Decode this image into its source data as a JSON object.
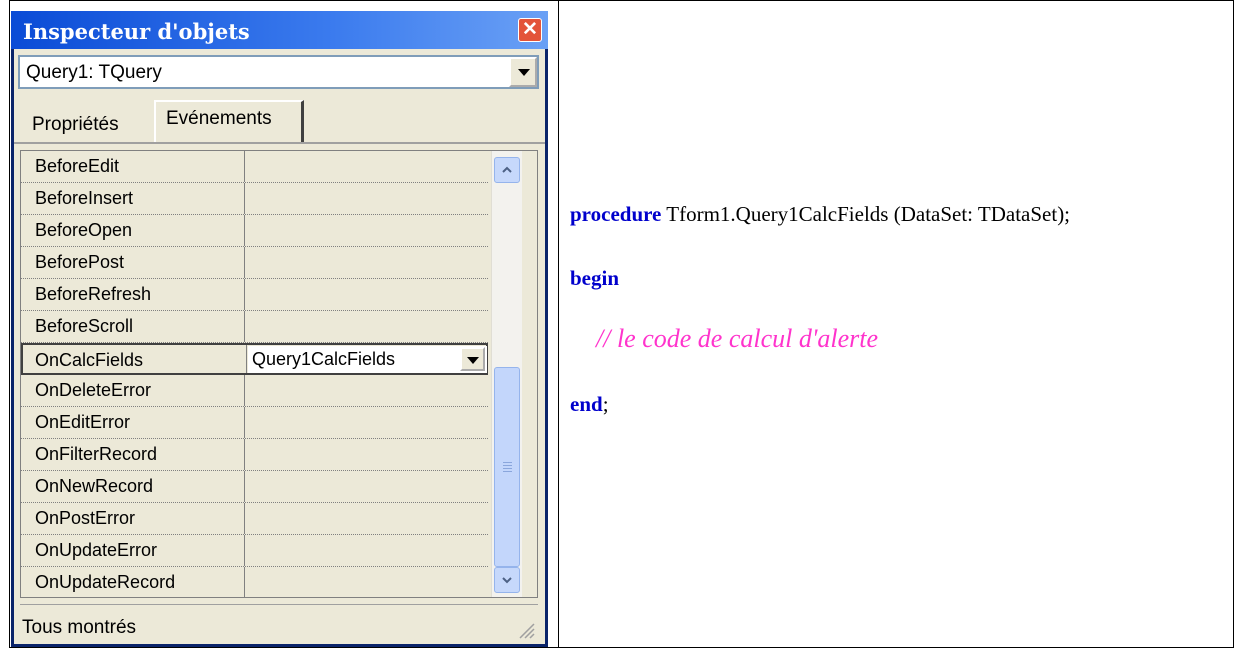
{
  "inspector": {
    "title": "Inspecteur d'objets",
    "object_selector": "Query1: TQuery",
    "tabs": [
      "Propriétés",
      "Evénements"
    ],
    "active_tab": "Evénements",
    "events": [
      {
        "name": "BeforeEdit",
        "value": ""
      },
      {
        "name": "BeforeInsert",
        "value": ""
      },
      {
        "name": "BeforeOpen",
        "value": ""
      },
      {
        "name": "BeforePost",
        "value": ""
      },
      {
        "name": "BeforeRefresh",
        "value": ""
      },
      {
        "name": "BeforeScroll",
        "value": ""
      },
      {
        "name": "OnCalcFields",
        "value": "Query1CalcFields"
      },
      {
        "name": "OnDeleteError",
        "value": ""
      },
      {
        "name": "OnEditError",
        "value": ""
      },
      {
        "name": "OnFilterRecord",
        "value": ""
      },
      {
        "name": "OnNewRecord",
        "value": ""
      },
      {
        "name": "OnPostError",
        "value": ""
      },
      {
        "name": "OnUpdateError",
        "value": ""
      },
      {
        "name": "OnUpdateRecord",
        "value": ""
      }
    ],
    "status": "Tous montrés"
  },
  "code": {
    "line1_keyword": "procedure",
    "line1_rest": " Tform1.Query1CalcFields (DataSet: TDataSet);",
    "line2_keyword": "begin",
    "line3_comment": "// le code de calcul d'alerte",
    "line4_keyword": "end",
    "line4_rest": ";"
  },
  "colors": {
    "keyword": "#0000cc",
    "comment": "#ff33cc",
    "title_bar": "#0a4bd6"
  }
}
